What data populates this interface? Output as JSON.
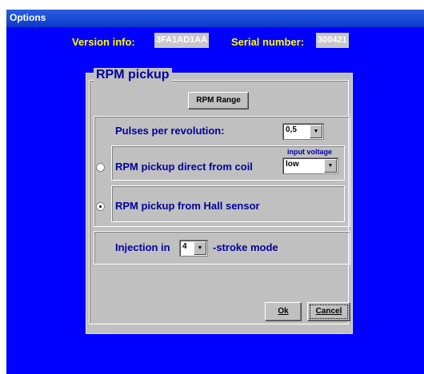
{
  "window": {
    "title": "Options"
  },
  "info": {
    "version_label": "Version info:",
    "version_value": "3FA1AD1AA",
    "serial_label": "Serial number:",
    "serial_value": "300421"
  },
  "rpm_group": {
    "title": "RPM pickup",
    "range_button": "RPM Range",
    "pulses_label": "Pulses per revolution:",
    "pulses_value": "0,5",
    "input_voltage_label": "input voltage",
    "coil_option": "RPM pickup direct from coil",
    "coil_selected": false,
    "voltage_value": "low",
    "hall_option": "RPM pickup from Hall sensor",
    "hall_selected": true
  },
  "injection": {
    "prefix": "Injection in",
    "value": "4",
    "suffix": "-stroke mode"
  },
  "buttons": {
    "ok": "Ok",
    "cancel": "Cancel"
  }
}
